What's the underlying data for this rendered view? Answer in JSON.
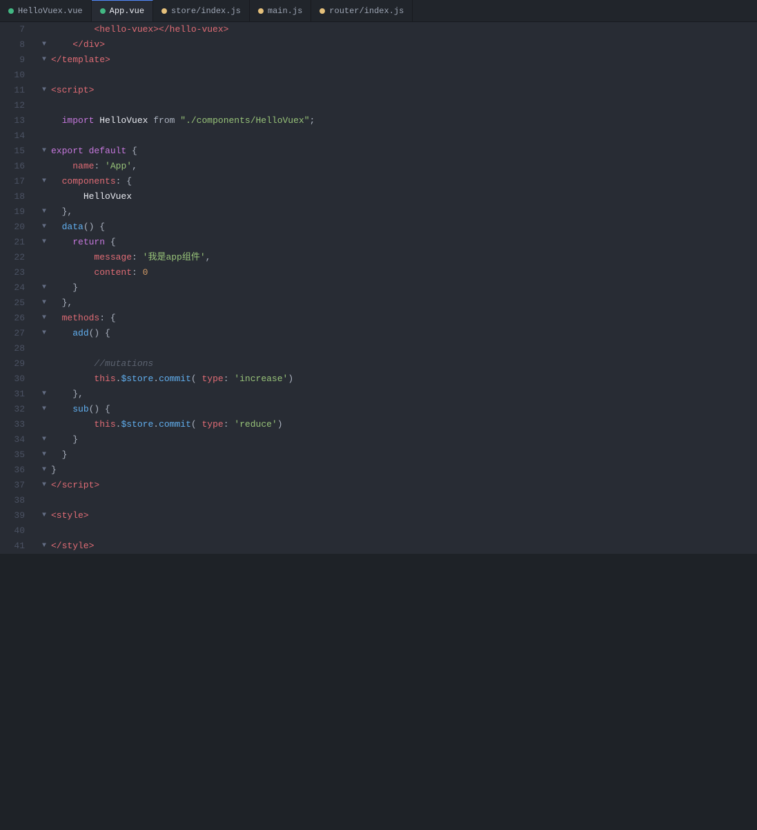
{
  "tabs": [
    {
      "id": "HelloVuex",
      "label": "HelloVuex.vue",
      "type": "vue",
      "active": false
    },
    {
      "id": "AppVue",
      "label": "App.vue",
      "type": "vue",
      "active": true
    },
    {
      "id": "storeIndex",
      "label": "store/index.js",
      "type": "js",
      "active": false
    },
    {
      "id": "mainJs",
      "label": "main.js",
      "type": "js",
      "active": false
    },
    {
      "id": "routerIndex",
      "label": "router/index.js",
      "type": "js",
      "active": false
    }
  ],
  "lines": [
    {
      "num": 7,
      "fold": null,
      "content": "hello-vuex-line"
    },
    {
      "num": 8,
      "fold": "close",
      "content": "div-close-line"
    },
    {
      "num": 9,
      "fold": "close",
      "content": "template-close-line"
    },
    {
      "num": 10,
      "fold": null,
      "content": "empty-line"
    },
    {
      "num": 11,
      "fold": "close",
      "content": "script-open-line"
    },
    {
      "num": 12,
      "fold": null,
      "content": "empty-line"
    },
    {
      "num": 13,
      "fold": null,
      "content": "import-line"
    },
    {
      "num": 14,
      "fold": null,
      "content": "empty-line"
    },
    {
      "num": 15,
      "fold": "open",
      "content": "export-default-line"
    },
    {
      "num": 16,
      "fold": null,
      "content": "name-line"
    },
    {
      "num": 17,
      "fold": "open",
      "content": "components-line"
    },
    {
      "num": 18,
      "fold": null,
      "content": "hellovuex-line"
    },
    {
      "num": 19,
      "fold": "close",
      "content": "components-close-line"
    },
    {
      "num": 20,
      "fold": "open",
      "content": "data-func-line"
    },
    {
      "num": 21,
      "fold": "open",
      "content": "return-line"
    },
    {
      "num": 22,
      "fold": null,
      "content": "message-line"
    },
    {
      "num": 23,
      "fold": null,
      "content": "content-line"
    },
    {
      "num": 24,
      "fold": "close",
      "content": "return-close-line"
    },
    {
      "num": 25,
      "fold": "close",
      "content": "data-close-line"
    },
    {
      "num": 26,
      "fold": "open",
      "content": "methods-line"
    },
    {
      "num": 27,
      "fold": "open",
      "content": "add-func-line"
    },
    {
      "num": 28,
      "fold": null,
      "content": "empty-line"
    },
    {
      "num": 29,
      "fold": null,
      "content": "comment-mutations-line"
    },
    {
      "num": 30,
      "fold": null,
      "content": "commit-increase-line"
    },
    {
      "num": 31,
      "fold": "close",
      "content": "add-close-line"
    },
    {
      "num": 32,
      "fold": "open",
      "content": "sub-func-line"
    },
    {
      "num": 33,
      "fold": null,
      "content": "commit-reduce-line"
    },
    {
      "num": 34,
      "fold": "close",
      "content": "sub-close-line"
    },
    {
      "num": 35,
      "fold": "close",
      "content": "methods-body-close-line"
    },
    {
      "num": 36,
      "fold": "close",
      "content": "export-close-line"
    },
    {
      "num": 37,
      "fold": "close",
      "content": "script-close-line"
    },
    {
      "num": 38,
      "fold": null,
      "content": "empty-line"
    },
    {
      "num": 39,
      "fold": "close",
      "content": "style-open-line"
    },
    {
      "num": 40,
      "fold": null,
      "content": "empty-line"
    },
    {
      "num": 41,
      "fold": "close",
      "content": "style-close-line"
    }
  ]
}
